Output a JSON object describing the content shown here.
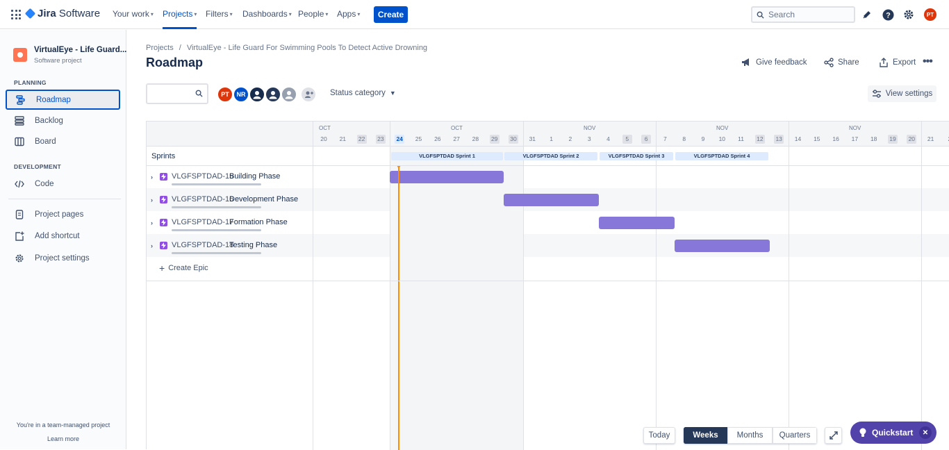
{
  "topnav": {
    "logo_text": "Jira Software",
    "your_work": "Your work",
    "projects": "Projects",
    "filters": "Filters",
    "dashboards": "Dashboards",
    "people": "People",
    "apps": "Apps",
    "create": "Create",
    "search_placeholder": "Search",
    "profile_initials": "PT"
  },
  "sidebar": {
    "project_name": "VirtualEye - Life Guard...",
    "project_type": "Software project",
    "planning_heading": "PLANNING",
    "roadmap": "Roadmap",
    "backlog": "Backlog",
    "board": "Board",
    "development_heading": "DEVELOPMENT",
    "code": "Code",
    "project_pages": "Project pages",
    "add_shortcut": "Add shortcut",
    "project_settings": "Project settings",
    "footer_text": "You're in a team-managed project",
    "learn_more": "Learn more"
  },
  "header": {
    "breadcrumb_projects": "Projects",
    "breadcrumb_sep": "/",
    "breadcrumb_project": "VirtualEye - Life Guard For Swimming Pools To Detect Active Drowning",
    "title": "Roadmap",
    "give_feedback": "Give feedback",
    "share": "Share",
    "export": "Export",
    "status_category": "Status category",
    "view_settings": "View settings"
  },
  "people": [
    {
      "initials": "PT",
      "color": "#de350b"
    },
    {
      "initials": "NR",
      "color": "#0052cc"
    },
    {
      "initials": "",
      "color": "#172b4d"
    },
    {
      "initials": "",
      "color": "#253858"
    },
    {
      "initials": "",
      "color": "#97a0af"
    }
  ],
  "timeline": {
    "months": [
      "OCT",
      "OCT",
      "NOV",
      "NOV",
      "NOV"
    ],
    "days": [
      "20",
      "21",
      "22",
      "23",
      "24",
      "25",
      "26",
      "27",
      "28",
      "29",
      "30",
      "31",
      "1",
      "2",
      "3",
      "4",
      "5",
      "6",
      "7",
      "8",
      "9",
      "10",
      "11",
      "12",
      "13",
      "14",
      "15",
      "16",
      "17",
      "18",
      "19",
      "20",
      "21",
      "2"
    ],
    "sprints_label": "Sprints",
    "sprints": [
      "VLGFSPTDAD Sprint 1",
      "VLGFSPTDAD Sprint 2",
      "VLGFSPTDAD Sprint 3",
      "VLGFSPTDAD Sprint 4"
    ],
    "create_epic": "Create Epic"
  },
  "epics": [
    {
      "key": "VLGFSPTDAD-15",
      "summary": "Building Phase"
    },
    {
      "key": "VLGFSPTDAD-16",
      "summary": "Development Phase"
    },
    {
      "key": "VLGFSPTDAD-17",
      "summary": "Formation Phase"
    },
    {
      "key": "VLGFSPTDAD-18",
      "summary": "Testing Phase"
    }
  ],
  "controls": {
    "today": "Today",
    "weeks": "Weeks",
    "months": "Months",
    "quarters": "Quarters",
    "quickstart": "Quickstart"
  },
  "colors": {
    "brand_blue": "#0052cc",
    "epic_bar": "#8777d9",
    "today_line": "#ff8b00",
    "quickstart_bg": "#5243aa"
  }
}
